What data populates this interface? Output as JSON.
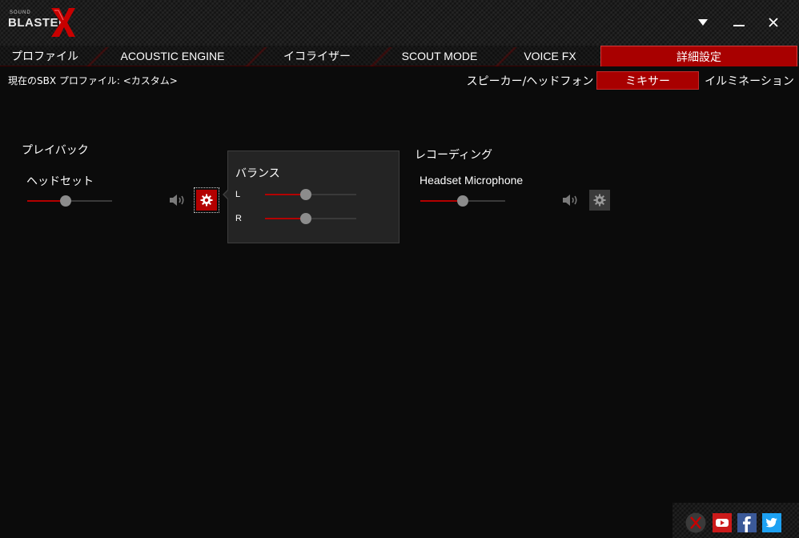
{
  "titlebar": {
    "logo_small": "SOUND",
    "logo_brand": "BLASTER",
    "window_buttons": [
      {
        "name": "dropdown",
        "glyph": "▼"
      },
      {
        "name": "minimize",
        "glyph": "—"
      },
      {
        "name": "close",
        "glyph": "✕"
      }
    ]
  },
  "tabs": [
    {
      "label": "プロファイル",
      "active": false
    },
    {
      "label": "ACOUSTIC ENGINE",
      "active": false
    },
    {
      "label": "イコライザー",
      "active": false
    },
    {
      "label": "SCOUT MODE",
      "active": false
    },
    {
      "label": "VOICE FX",
      "active": false
    },
    {
      "label": "詳細設定",
      "active": true
    }
  ],
  "profile": {
    "label": "現在のSBX プロファイル: <カスタム>"
  },
  "subtabs": [
    {
      "label": "スピーカー/ヘッドフォン",
      "active": false
    },
    {
      "label": "ミキサー",
      "active": true
    },
    {
      "label": "イルミネーション",
      "active": false
    }
  ],
  "playback": {
    "section_title": "プレイバック",
    "device_name": "ヘッドセット",
    "volume": 0.45
  },
  "balance_popup": {
    "title": "バランス",
    "channels": [
      {
        "label": "L",
        "value": 0.45
      },
      {
        "label": "R",
        "value": 0.45
      }
    ]
  },
  "recording": {
    "section_title": "レコーディング",
    "device_name": "Headset Microphone",
    "volume": 0.5
  },
  "icons": {
    "speaker": "speaker-icon",
    "gear": "gear-icon"
  },
  "colors": {
    "accent": "#a80000",
    "slider_fill": "#b40000",
    "thumb": "#8c8c8c",
    "background": "#0b0b0b"
  },
  "social": [
    "x-close",
    "youtube",
    "facebook",
    "twitter"
  ]
}
